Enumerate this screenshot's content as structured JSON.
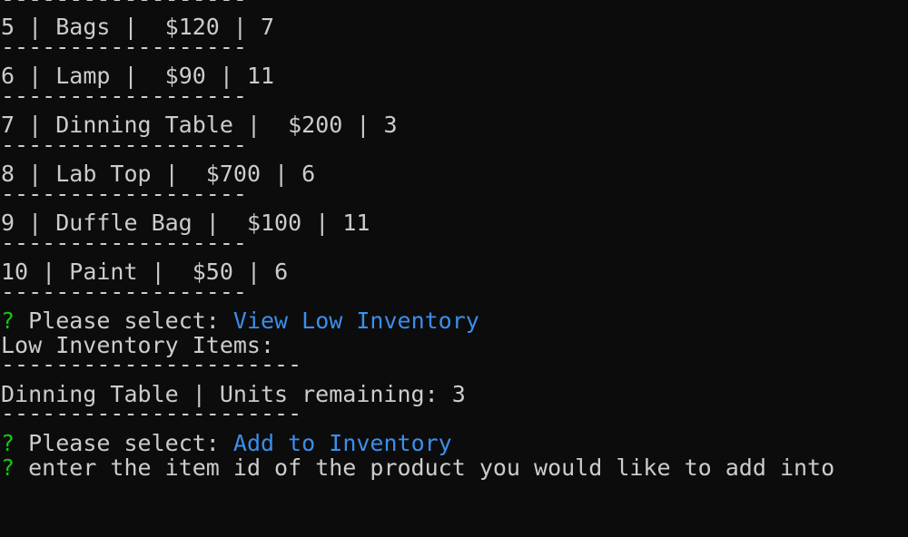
{
  "separators": {
    "short": "------------------",
    "long": "----------------------"
  },
  "products": [
    {
      "id": "5",
      "name": "Bags",
      "price": "$120",
      "qty": "7"
    },
    {
      "id": "6",
      "name": "Lamp",
      "price": "$90",
      "qty": "11"
    },
    {
      "id": "7",
      "name": "Dinning Table",
      "price": "$200",
      "qty": "3"
    },
    {
      "id": "8",
      "name": "Lab Top",
      "price": "$700",
      "qty": "6"
    },
    {
      "id": "9",
      "name": "Duffle Bag",
      "price": "$100",
      "qty": "11"
    },
    {
      "id": "10",
      "name": "Paint",
      "price": "$50",
      "qty": "6"
    }
  ],
  "prompt_symbol": "?",
  "prompt1": {
    "label": "Please select:",
    "answer": "View Low Inventory"
  },
  "low_inventory": {
    "heading": "Low Inventory Items:",
    "item": "Dinning Table | Units remaining: 3"
  },
  "prompt2": {
    "label": "Please select:",
    "answer": "Add to Inventory"
  },
  "prompt3": {
    "label": "enter the item id of the product you would like to add into"
  },
  "colors": {
    "background": "#0c0c0c",
    "text": "#cccccc",
    "question_mark": "#16c60c",
    "answer": "#3b8eea"
  }
}
